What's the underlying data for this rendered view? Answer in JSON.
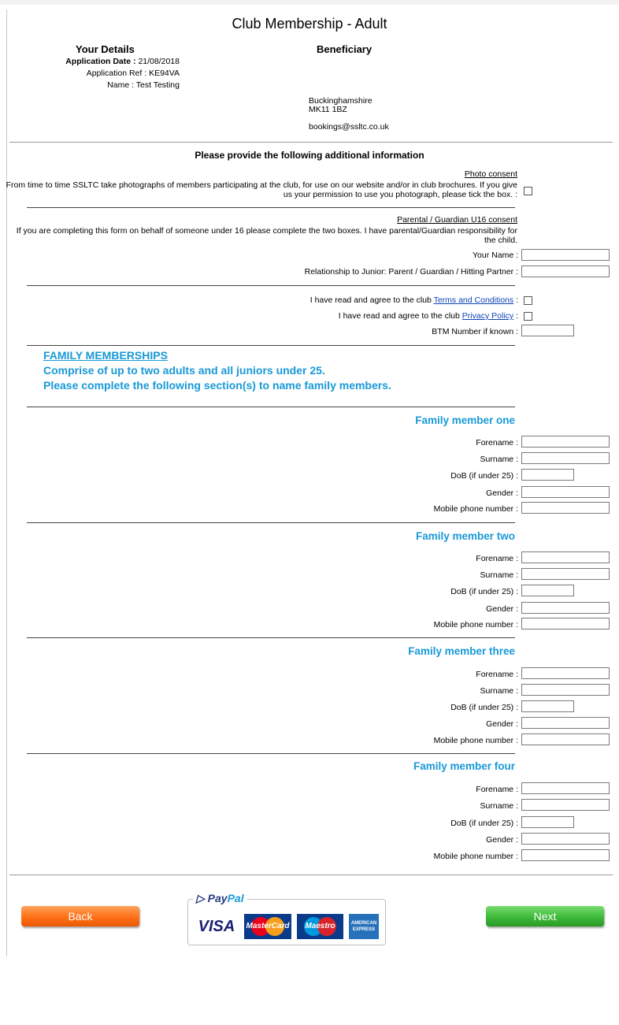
{
  "page": {
    "title": "Club Membership - Adult"
  },
  "your_details": {
    "heading": "Your Details",
    "app_date_label": "Application Date :",
    "app_date_value": "21/08/2018",
    "app_ref_label": "Application Ref :",
    "app_ref_value": "KE94VA",
    "name_label": "Name :",
    "name_value": "Test Testing"
  },
  "beneficiary": {
    "heading": "Beneficiary",
    "county": "Buckinghamshire",
    "postcode": "MK11 1BZ",
    "email": "bookings@ssltc.co.uk"
  },
  "additional": {
    "heading": "Please provide the following additional information",
    "photo_heading": "Photo consent",
    "photo_text_1": "From time to time SSLTC take photographs of members participating at the club, for use on our website and/or in club brochures. If you give",
    "photo_text_2": "us your permission to use you photograph, please tick the box. :",
    "guardian_heading": "Parental / Guardian U16 consent",
    "guardian_text_1": "If you are completing this form on behalf of someone under 16 please complete the two boxes. I have parental/Guardian responsibility for",
    "guardian_text_2": "the child.",
    "your_name_label": "Your Name :",
    "relationship_label": "Relationship to Junior: Parent / Guardian / Hitting Partner :",
    "terms_prefix": "I have read and agree to the club",
    "terms_link": "Terms and Conditions",
    "privacy_prefix": "I have read and agree to the club",
    "privacy_link": "Privacy Policy",
    "link_suffix": " :",
    "btm_label": "BTM Number if known :"
  },
  "family": {
    "heading": "FAMILY MEMBERSHIPS",
    "line1": "Comprise of up to two adults and all juniors under 25.",
    "line2": "Please complete the following section(s) to name family members.",
    "field_labels": {
      "forename": "Forename :",
      "surname": "Surname :",
      "dob": "DoB (if under 25) :",
      "gender": "Gender :",
      "mobile": "Mobile phone number :"
    },
    "members": [
      {
        "title": "Family member one"
      },
      {
        "title": "Family member two"
      },
      {
        "title": "Family member three"
      },
      {
        "title": "Family member four"
      }
    ]
  },
  "buttons": {
    "back": "Back",
    "next": "Next"
  },
  "payment": {
    "paypal_p1": "Pay",
    "paypal_p2": "Pal",
    "visa": "VISA",
    "mastercard": "MasterCard",
    "maestro": "Maestro",
    "amex_1": "AMERICAN",
    "amex_2": "EXPRESS"
  }
}
